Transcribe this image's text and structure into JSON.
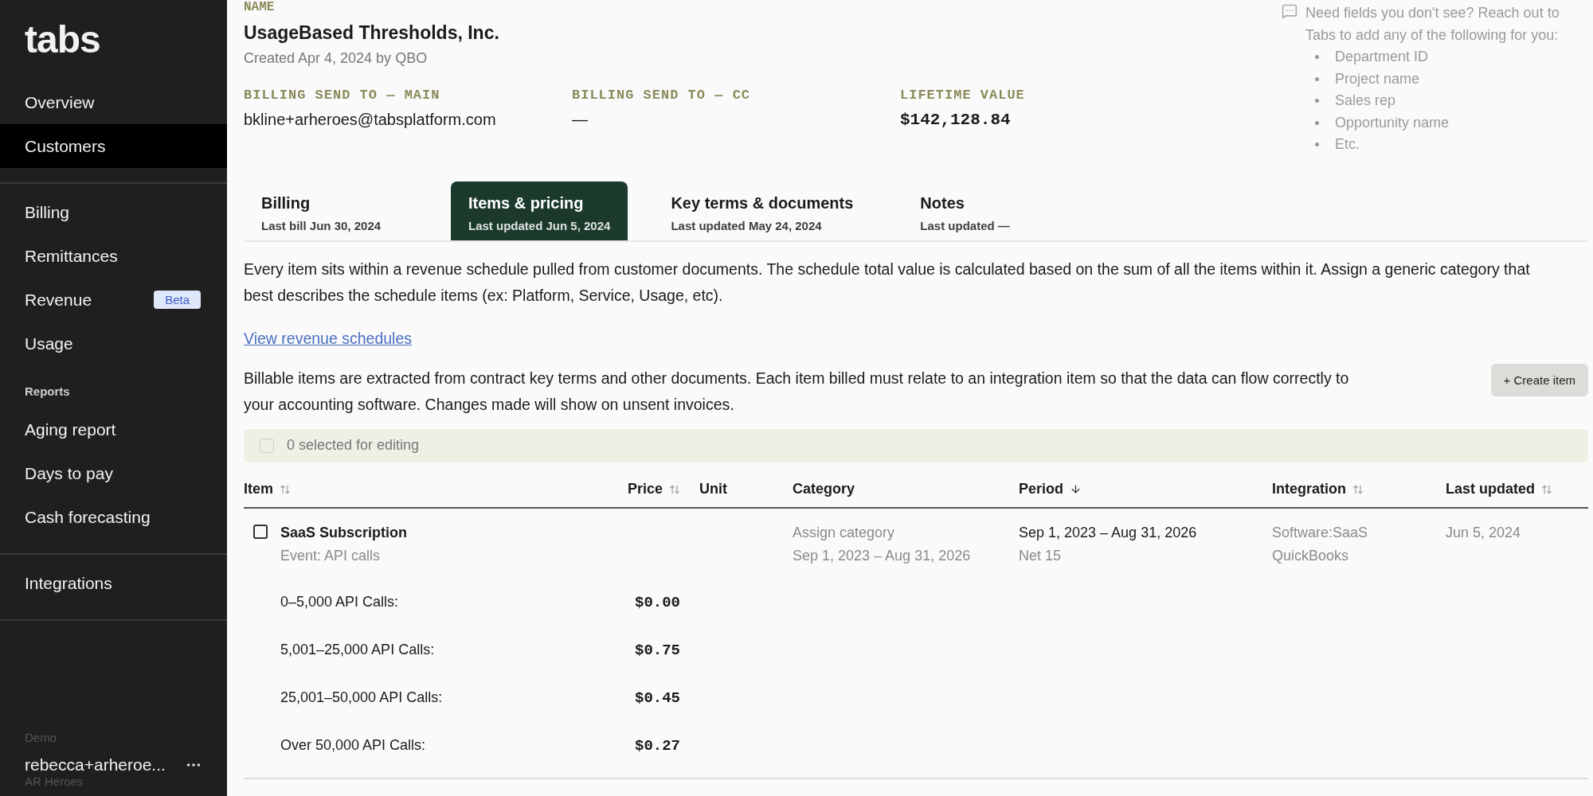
{
  "sidebar": {
    "logo": "tabs",
    "groups": [
      [
        {
          "kind": "link",
          "label": "Overview",
          "selected": false
        },
        {
          "kind": "link",
          "label": "Customers",
          "selected": true
        }
      ],
      [
        {
          "kind": "link",
          "label": "Billing",
          "selected": false
        },
        {
          "kind": "link",
          "label": "Remittances",
          "selected": false
        },
        {
          "kind": "link",
          "label": "Revenue",
          "selected": false,
          "badge": "Beta"
        },
        {
          "kind": "link",
          "label": "Usage",
          "selected": false
        },
        {
          "kind": "heading",
          "label": "Reports"
        },
        {
          "kind": "link",
          "label": "Aging report",
          "selected": false
        },
        {
          "kind": "link",
          "label": "Days to pay",
          "selected": false
        },
        {
          "kind": "link",
          "label": "Cash forecasting",
          "selected": false
        }
      ],
      [
        {
          "kind": "link",
          "label": "Integrations",
          "selected": false
        }
      ]
    ],
    "footer": {
      "workspace": "Demo",
      "user": "rebecca+arheroe...",
      "org": "AR Heroes"
    }
  },
  "customer": {
    "name_label": "NAME",
    "name": "UsageBased Thresholds, Inc.",
    "created": "Created Apr 4, 2024 by QBO",
    "fields": [
      {
        "label": "BILLING SEND TO — MAIN",
        "value": "bkline+arheroes@tabsplatform.com",
        "kind": "text"
      },
      {
        "label": "BILLING SEND TO — CC",
        "value": "—",
        "kind": "text"
      },
      {
        "label": "LIFETIME VALUE",
        "value": "$142,128.84",
        "kind": "money"
      }
    ]
  },
  "help_note": {
    "text": "Need fields you don't see? Reach out to Tabs to add any of the following for you:",
    "items": [
      "Department ID",
      "Project name",
      "Sales rep",
      "Opportunity name",
      "Etc."
    ]
  },
  "tabs": [
    {
      "title": "Billing",
      "subtitle": "Last bill Jun 30, 2024",
      "selected": false
    },
    {
      "title": "Items & pricing",
      "subtitle": "Last updated Jun 5, 2024",
      "selected": true
    },
    {
      "title": "Key terms & documents",
      "subtitle": "Last updated May 24, 2024",
      "selected": false
    },
    {
      "title": "Notes",
      "subtitle": "Last updated —",
      "selected": false
    }
  ],
  "intro": "Every item sits within a revenue schedule pulled from customer documents. The schedule total value is calculated based on the sum of all the items within it. Assign a generic category that best describes the schedule items (ex: Platform, Service, Usage, etc).",
  "link": "View revenue schedules",
  "billable_note": "Billable items are extracted from contract key terms and other documents. Each item billed must relate to an integration item so that the data can flow correctly to your accounting software. Changes made will show on unsent invoices.",
  "create_button": "+ Create item",
  "selection": {
    "label": "0 selected for editing",
    "checked": false
  },
  "table": {
    "columns": [
      {
        "label": "Item",
        "sortable": true,
        "sorted": false
      },
      {
        "label": "Price",
        "sortable": true,
        "sorted": false
      },
      {
        "label": "Unit",
        "sortable": false,
        "sorted": false
      },
      {
        "label": "Category",
        "sortable": false,
        "sorted": false
      },
      {
        "label": "Period",
        "sortable": true,
        "sorted": true
      },
      {
        "label": "Integration",
        "sortable": true,
        "sorted": false
      },
      {
        "label": "Last updated",
        "sortable": true,
        "sorted": false
      }
    ],
    "rows": [
      {
        "checked": false,
        "item": "SaaS Subscription",
        "item_sub": "Event: API calls",
        "category": "Assign category",
        "category_sub": "Sep 1, 2023 – Aug 31, 2026",
        "period": "Sep 1, 2023 – Aug 31, 2026",
        "period_sub": "Net 15",
        "integration": "Software:SaaS",
        "integration_sub": "QuickBooks",
        "updated": "Jun 5, 2024",
        "tiers": [
          {
            "label": "0–5,000 API Calls:",
            "price": "$0.00"
          },
          {
            "label": "5,001–25,000 API Calls:",
            "price": "$0.75"
          },
          {
            "label": "25,001–50,000 API Calls:",
            "price": "$0.45"
          },
          {
            "label": "Over 50,000 API Calls:",
            "price": "$0.27"
          }
        ]
      }
    ]
  }
}
